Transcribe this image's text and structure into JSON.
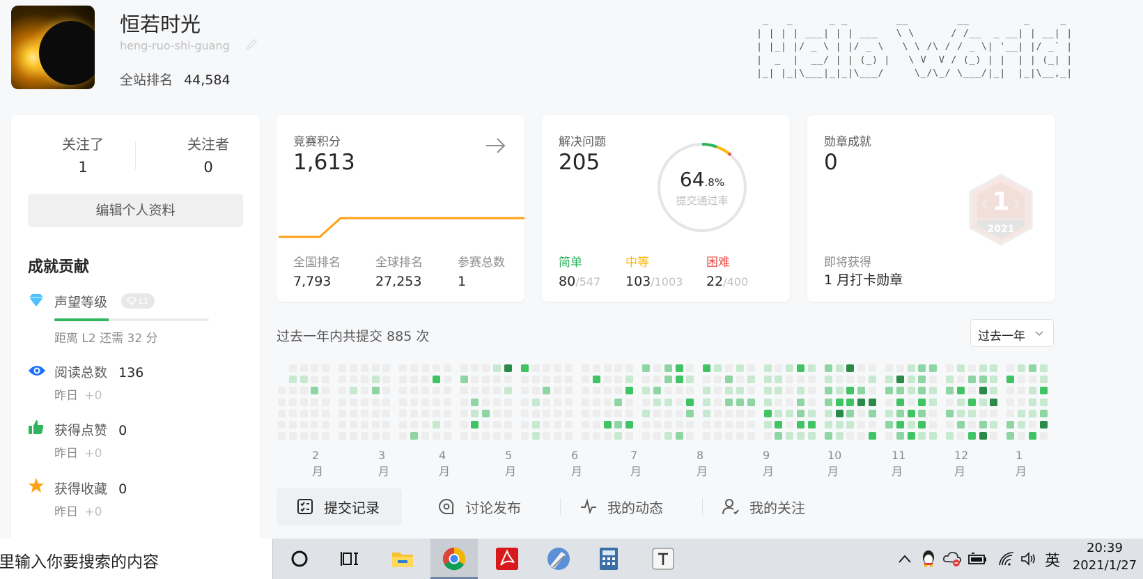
{
  "profile": {
    "name": "恒若时光",
    "username": "heng-ruo-shi-guang",
    "rank_label": "全站排名",
    "rank_value": "44,584"
  },
  "ascii_banner": [
    " _   _      _ _        __        __         _     _ ",
    "| | | | ___| | | ___   \\ \\      / /__  _ __| | __| |",
    "| |_| |/ _ \\ | |/ _ \\   \\ \\ /\\ / / _ \\| '__| |/ _` |",
    "|  _  |  __/ | | (_) |   \\ V  V / (_) | |  | | (_| |",
    "|_| |_|\\___|_|_|\\___/     \\_/\\_/ \\___/|_|  |_|\\__,_|"
  ],
  "sidebar": {
    "following_label": "关注了",
    "following_count": "1",
    "followers_label": "关注者",
    "followers_count": "0",
    "edit_button": "编辑个人资料",
    "section_title": "成就贡献",
    "reputation_label": "声望等级",
    "reputation_level": "L1",
    "reputation_progress": 0.35,
    "reputation_hint": "距离 L2 还需 32 分",
    "stats": [
      {
        "label": "阅读总数",
        "value": "136",
        "yesterday": "昨日",
        "delta": "+0",
        "icon": "eye-icon"
      },
      {
        "label": "获得点赞",
        "value": "0",
        "yesterday": "昨日",
        "delta": "+0",
        "icon": "thumbs-up-icon"
      },
      {
        "label": "获得收藏",
        "value": "0",
        "yesterday": "昨日",
        "delta": "+0",
        "icon": "star-icon"
      }
    ]
  },
  "contest": {
    "title": "竞赛积分",
    "score": "1,613",
    "stats": [
      {
        "label": "全国排名",
        "value": "7,793"
      },
      {
        "label": "全球排名",
        "value": "27,253"
      },
      {
        "label": "参赛总数",
        "value": "1"
      }
    ],
    "line_color": "#ffa116"
  },
  "solved": {
    "title": "解决问题",
    "count": "205",
    "rate_int": "64",
    "rate_dec": ".8%",
    "rate_label": "提交通过率",
    "easy_label": "简单",
    "easy_solved": "80",
    "easy_total": "547",
    "medium_label": "中等",
    "medium_solved": "103",
    "medium_total": "1003",
    "hard_label": "困难",
    "hard_solved": "22",
    "hard_total": "400",
    "colors": {
      "easy": "#2db55d",
      "medium": "#ffb800",
      "hard": "#ef4743"
    }
  },
  "badges": {
    "title": "勋章成就",
    "count": "0",
    "upcoming_label": "即将获得",
    "upcoming_name": "1 月打卡勋章",
    "badge_number": "1",
    "badge_year": "2021"
  },
  "submissions": {
    "summary": "过去一年内共提交 885 次",
    "range_select": "过去一年",
    "months": [
      "2 月",
      "3 月",
      "4 月",
      "5 月",
      "6 月",
      "7 月",
      "8 月",
      "9 月",
      "10 月",
      "11 月",
      "12 月",
      "1 月"
    ]
  },
  "tabs": [
    {
      "label": "提交记录",
      "icon": "checklist-icon",
      "active": true
    },
    {
      "label": "讨论发布",
      "icon": "discussion-icon",
      "active": false
    },
    {
      "label": "我的动态",
      "icon": "activity-icon",
      "active": false
    },
    {
      "label": "我的关注",
      "icon": "user-follow-icon",
      "active": false
    }
  ],
  "taskbar": {
    "search_placeholder": "里输入你要搜索的内容",
    "ime": "英",
    "time": "20:39",
    "date": "2021/1/27"
  }
}
